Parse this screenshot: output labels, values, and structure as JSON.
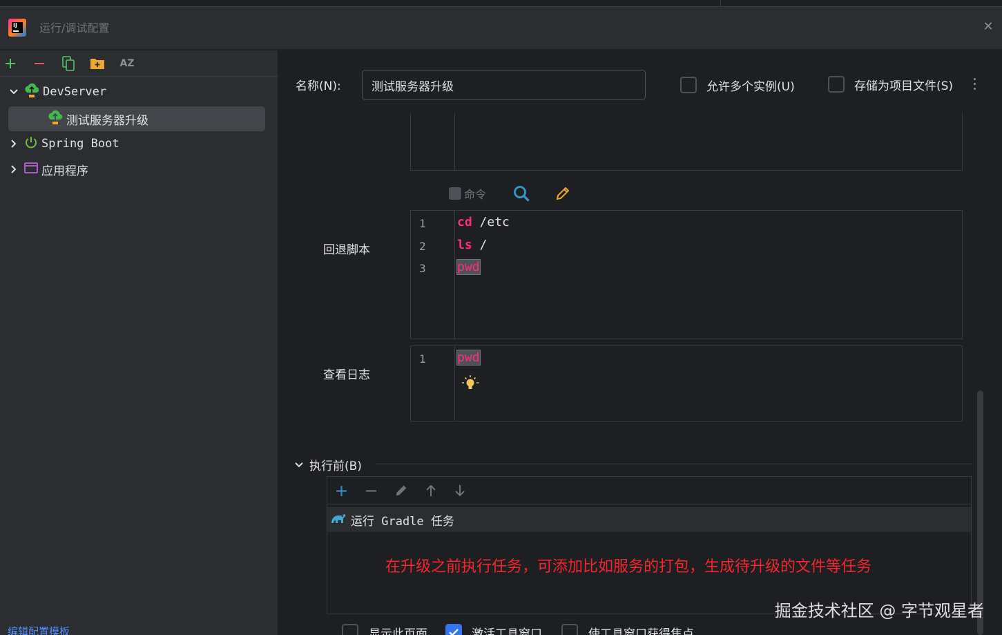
{
  "window": {
    "title": "运行/调试配置",
    "logo_text": "IJ"
  },
  "left_toolbar": {
    "icons": [
      "add-icon",
      "remove-icon",
      "copy-icon",
      "new-folder-icon",
      "sort-az-icon"
    ],
    "sort_label": "AZ"
  },
  "tree": {
    "items": [
      {
        "label": "DevServer",
        "icon": "deploy-cloud-icon",
        "expanded": true
      },
      {
        "label": "测试服务器升级",
        "icon": "deploy-cloud-icon",
        "selected": true
      },
      {
        "label": "Spring Boot",
        "icon": "power-icon",
        "expanded": false
      },
      {
        "label": "应用程序",
        "icon": "application-window-icon",
        "expanded": false
      }
    ]
  },
  "edit_template_link": "编辑配置模板",
  "form": {
    "name_label": "名称(N):",
    "name_value": "测试服务器升级",
    "allow_multiple_label": "允许多个实例(U)",
    "store_as_file_label": "存储为项目文件(S)",
    "command_label": "命令"
  },
  "rollback": {
    "label": "回退脚本",
    "lines": [
      {
        "num": "1",
        "cmd": "cd",
        "arg": " /etc"
      },
      {
        "num": "2",
        "cmd": "ls",
        "arg": " /"
      },
      {
        "num": "3",
        "cmd": "pwd",
        "arg": ""
      }
    ]
  },
  "view_log": {
    "label": "查看日志",
    "lines": [
      {
        "num": "1",
        "cmd": "pwd"
      }
    ]
  },
  "before_launch": {
    "title": "执行前(B)",
    "task_label": "运行 Gradle 任务",
    "annotation": "在升级之前执行任务，可添加比如服务的打包，生成待升级的文件等任务"
  },
  "bottom_options": {
    "show_page_label": "显示此页面",
    "activate_window_label": "激活工具窗口",
    "focus_window_label": "使工具窗口获得焦点",
    "activate_checked": true
  },
  "watermark": "掘金技术社区 @ 字节观星者",
  "colors": {
    "accent": "#3574f0",
    "keyword": "#ff2e7e",
    "annotation": "#f2262e",
    "link": "#548af7"
  }
}
